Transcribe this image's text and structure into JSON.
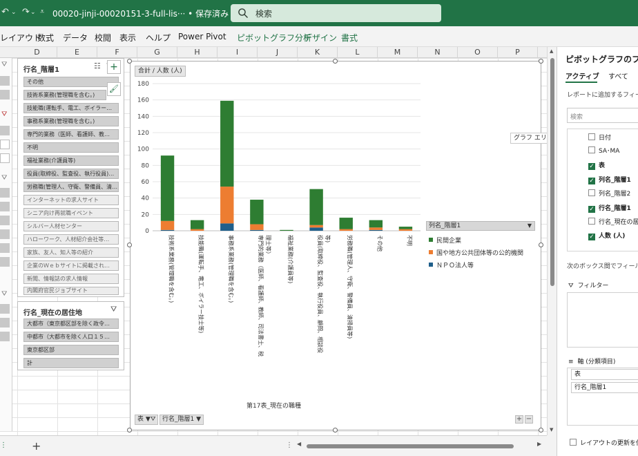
{
  "app": {
    "doc_title": "00020-jinji-00020151-3-full-lis···",
    "save_state": "• 保存済み",
    "search_placeholder": "検索"
  },
  "ribbon_tabs": [
    "レイアウト",
    "数式",
    "データ",
    "校閲",
    "表示",
    "ヘルプ",
    "Power Pivot",
    "ピボットグラフ分析",
    "デザイン",
    "書式"
  ],
  "columns": [
    "D",
    "E",
    "F",
    "G",
    "H",
    "I",
    "J",
    "K",
    "L",
    "M",
    "N",
    "O",
    "P"
  ],
  "slicer_rows": {
    "title": "行名_階層1",
    "items": [
      "その他",
      "技術系業務(管理職を含む。)",
      "技能職(運転手、電工、ボイラー…",
      "事務系業務(管理職を含む。)",
      "専門的業務（医師、看護師、教…",
      "不明",
      "福祉業務(介護員等)",
      "役員(取締役、監査役、執行役員)…",
      "労務職(管理人、守衛、警備員、清…",
      "インターネットの求人サイト",
      "シニア向け再就職イベント",
      "シルバー人材センター",
      "ハローワーク、人材紹介会社等…",
      "家族、友人、知人等の紹介",
      "企業のＷｅｂサイトに掲載され…",
      "新聞、情報誌の求人情報",
      "内閣府官民ジョブサイト"
    ]
  },
  "slicer_residence": {
    "title": "行名_現在の居住地",
    "items": [
      "大都市（東京都区部を除く政令…",
      "中都市（大都市を除く人口１５…",
      "東京都区部",
      "計"
    ]
  },
  "chart": {
    "field_title": "合計 / 人数 (人)",
    "legend_title": "列名_階層1",
    "axis_field_buttons": [
      "表",
      "行名_階層1"
    ],
    "tooltip": "グラフ エリア",
    "plus": "+",
    "minus": "−"
  },
  "chart_data": {
    "type": "bar",
    "stacked": true,
    "xlabel": "第17表_現在の職種",
    "ylabel": "",
    "ylim": [
      0,
      180
    ],
    "yticks": [
      0,
      20,
      40,
      60,
      80,
      100,
      120,
      140,
      160,
      180
    ],
    "categories": [
      "技術系業務(管理職を含む。)",
      "技能職(運転手、電工、ボイラー技士等)",
      "事務系業務(管理職を含む。)",
      "専門的業務（医師、看護師、教師、司法書士、税理士等）",
      "福祉業務(介護員等)",
      "役員(取締役、監査役、執行役員、顧問、相談役等)",
      "労務職(管理人、守衛、警備員、清掃員等)",
      "その他",
      "不明"
    ],
    "series": [
      {
        "name": "民間企業",
        "color": "#2e7d32",
        "values": [
          80,
          11,
          105,
          30,
          1,
          44,
          14,
          9,
          3
        ]
      },
      {
        "name": "国や地方公共団体等の公的機関",
        "color": "#ed7d31",
        "values": [
          11,
          2,
          45,
          7,
          0,
          3,
          2,
          3,
          2
        ]
      },
      {
        "name": "ＮＰＯ法人等",
        "color": "#1f5f8b",
        "values": [
          1,
          0,
          9,
          1,
          0,
          4,
          0,
          1,
          0
        ]
      }
    ]
  },
  "field_pane": {
    "title": "ピボットグラフのフィー",
    "tab_active": "アクティブ",
    "tab_all": "すべて",
    "add_label": "レポートに追加するフィール",
    "search_placeholder": "検索",
    "fields": [
      {
        "label": "日付",
        "checked": false
      },
      {
        "label": "SA･MA",
        "checked": false
      },
      {
        "label": "表",
        "checked": true
      },
      {
        "label": "列名_階層1",
        "checked": true
      },
      {
        "label": "列名_階層2",
        "checked": false
      },
      {
        "label": "行名_階層1",
        "checked": true
      },
      {
        "label": "行名_現在の居",
        "checked": false
      },
      {
        "label": "人数 (人)",
        "checked": true
      }
    ],
    "drag_label": "次のボックス間でフィールド",
    "filter_label": "フィルター",
    "axis_label": "軸 (分類項目)",
    "axis_items": [
      "表",
      "行名_階層1"
    ],
    "defer_label": "レイアウトの更新を保"
  }
}
